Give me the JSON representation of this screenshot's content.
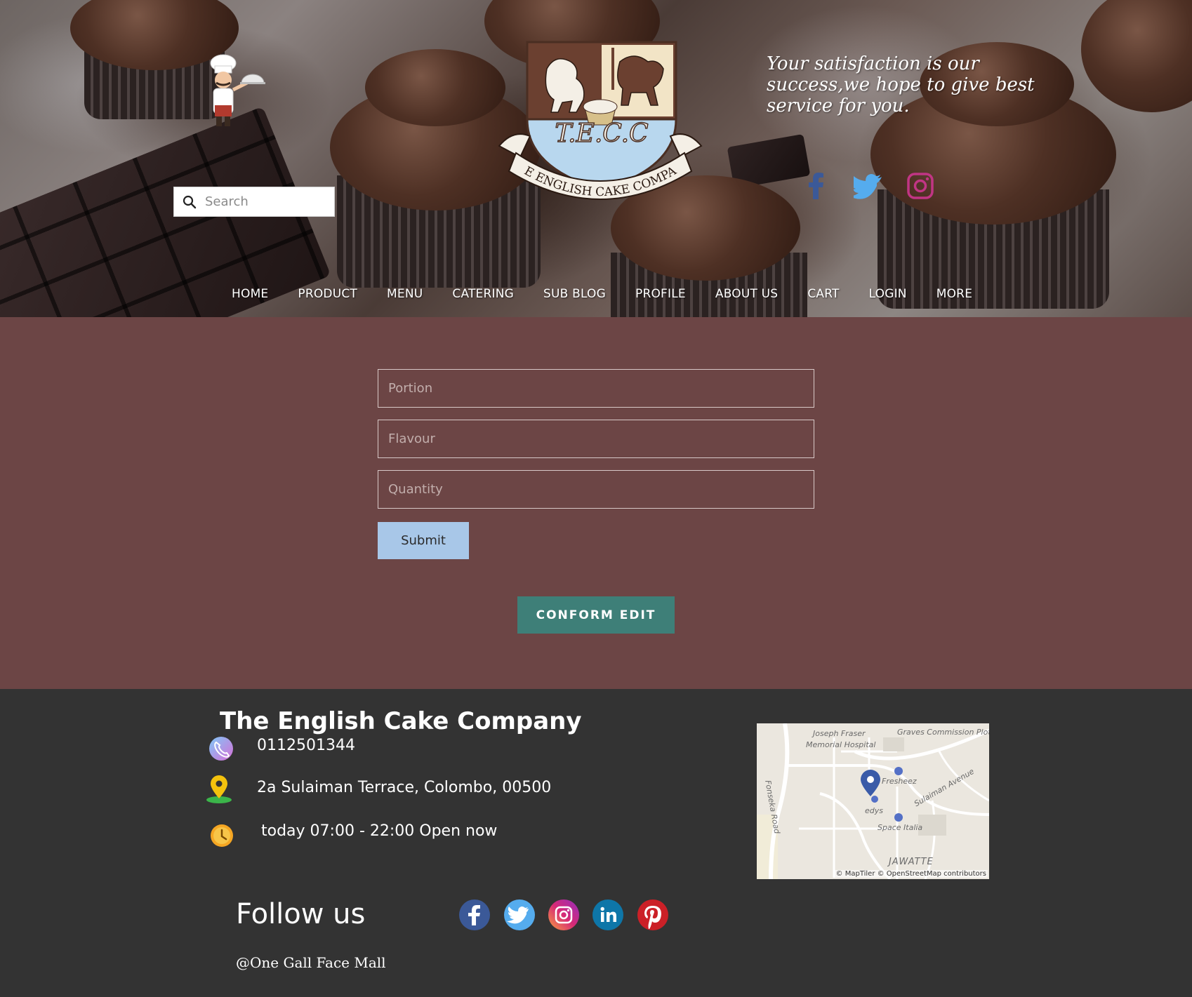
{
  "header": {
    "search": {
      "placeholder": "Search"
    },
    "logo": {
      "initials": "T.E.C.C",
      "banner": "THE ENGLISH CAKE COMPANY"
    },
    "tagline": "Your satisfaction is our success,we hope to give best service for you.",
    "social": [
      {
        "icon": "facebook-icon",
        "color": "#3b5998"
      },
      {
        "icon": "twitter-icon",
        "color": "#55acee"
      },
      {
        "icon": "instagram-icon",
        "color": "#c13584"
      }
    ],
    "nav": [
      {
        "label": "HOME"
      },
      {
        "label": "PRODUCT"
      },
      {
        "label": "MENU"
      },
      {
        "label": "CATERING"
      },
      {
        "label": "SUB BLOG"
      },
      {
        "label": "PROFILE"
      },
      {
        "label": "ABOUT US"
      },
      {
        "label": "CART"
      },
      {
        "label": "LOGIN"
      },
      {
        "label": "MORE"
      }
    ]
  },
  "form": {
    "portion_placeholder": "Portion",
    "flavour_placeholder": "Flavour",
    "quantity_placeholder": "Quantity",
    "submit_label": "Submit",
    "conform_label": "CONFORM EDIT"
  },
  "footer": {
    "company_name": "The English Cake Company",
    "phone": "0112501344",
    "address": "2a Sulaiman Terrace, Colombo, 00500",
    "hours": "today 07:00 - 22:00 Open now",
    "map": {
      "labels": [
        "Joseph Fraser",
        "Memorial Hospital",
        "Graves Commission Plot",
        "Fonseka Road",
        "Fresheez",
        "Sulaiman Avenue",
        "edys",
        "Space Italia",
        "JAWATTE"
      ],
      "attribution": "© MapTiler © OpenStreetMap contributors"
    },
    "follow_label": "Follow us",
    "follow_social": [
      {
        "icon": "facebook-icon",
        "color": "#3b5998"
      },
      {
        "icon": "twitter-icon",
        "color": "#55acee"
      },
      {
        "icon": "instagram-icon",
        "color": "#c13584"
      },
      {
        "icon": "linkedin-icon",
        "color": "#0e76a8"
      },
      {
        "icon": "pinterest-icon",
        "color": "#cb2027"
      }
    ],
    "mall": "@One Gall Face Mall"
  },
  "colors": {
    "main_bg": "#6c4545",
    "footer_bg": "#333333",
    "submit_bg": "#a8c7e8",
    "conform_bg": "#3e7f78"
  }
}
